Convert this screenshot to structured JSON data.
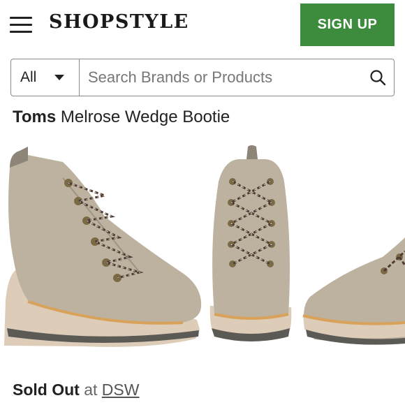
{
  "header": {
    "logo": "SHOPSTYLE",
    "signup_label": "SIGN UP"
  },
  "search": {
    "category": "All",
    "placeholder": "Search Brands or Products"
  },
  "product": {
    "brand": "Toms",
    "name": "Melrose Wedge Bootie",
    "status": "Sold Out",
    "at": "at",
    "store": "DSW"
  },
  "colors": {
    "signup": "#3d8b3d",
    "suede": "#bcb29f",
    "sole": "#d7c7b3"
  },
  "icons": [
    "menu-icon",
    "chevron-down-icon",
    "search-icon"
  ]
}
